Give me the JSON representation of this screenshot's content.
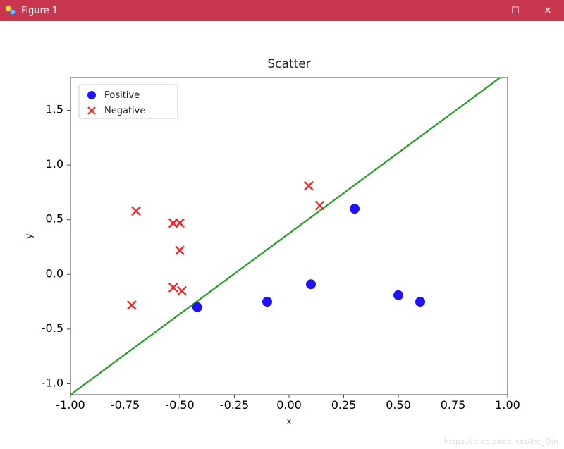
{
  "window": {
    "title": "Figure 1",
    "buttons": {
      "min": "–",
      "max": "☐",
      "close": "✕"
    }
  },
  "watermark": "https://blog.csdn.net/Int_Qin",
  "chart_data": {
    "type": "scatter",
    "title": "Scatter",
    "xlabel": "x",
    "ylabel": "y",
    "xlim": [
      -1.0,
      1.0
    ],
    "ylim": [
      -1.1,
      1.8
    ],
    "xticks": [
      -1.0,
      -0.75,
      -0.5,
      -0.25,
      0.0,
      0.25,
      0.5,
      0.75,
      1.0
    ],
    "yticks": [
      -1.0,
      -0.5,
      0.0,
      0.5,
      1.0,
      1.5
    ],
    "legend": {
      "position": "upper left",
      "entries": [
        "Positive",
        "Negative"
      ]
    },
    "series": [
      {
        "name": "Positive",
        "marker": "circle",
        "color": "#1f10ff",
        "points": [
          {
            "x": -0.42,
            "y": -0.3
          },
          {
            "x": -0.1,
            "y": -0.25
          },
          {
            "x": 0.1,
            "y": -0.09
          },
          {
            "x": 0.3,
            "y": 0.6
          },
          {
            "x": 0.5,
            "y": -0.19
          },
          {
            "x": 0.6,
            "y": -0.25
          }
        ]
      },
      {
        "name": "Negative",
        "marker": "x",
        "color": "#ff1e1e",
        "points": [
          {
            "x": -0.7,
            "y": 0.58
          },
          {
            "x": -0.72,
            "y": -0.28
          },
          {
            "x": -0.53,
            "y": 0.47
          },
          {
            "x": -0.5,
            "y": 0.47
          },
          {
            "x": -0.5,
            "y": 0.22
          },
          {
            "x": -0.53,
            "y": -0.12
          },
          {
            "x": -0.49,
            "y": -0.15
          },
          {
            "x": 0.09,
            "y": 0.81
          },
          {
            "x": 0.14,
            "y": 0.63
          }
        ]
      }
    ],
    "line": {
      "color": "#2aa02a",
      "x1": -1.0,
      "y1": -1.1,
      "x2": 1.0,
      "y2": 1.85
    }
  }
}
